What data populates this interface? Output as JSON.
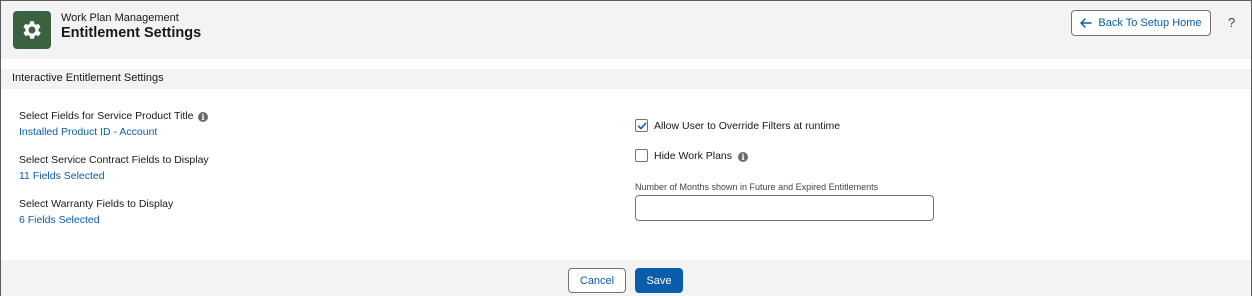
{
  "header": {
    "app_icon": "gear-icon",
    "subtitle": "Work Plan Management",
    "title": "Entitlement Settings",
    "back_button_label": "Back To Setup Home",
    "back_icon": "arrow-left-icon",
    "help_label": "?"
  },
  "section": {
    "title": "Interactive Entitlement Settings"
  },
  "left_fields": [
    {
      "label": "Select Fields for Service Product Title",
      "value": "Installed Product ID - Account",
      "has_info_icon": true
    },
    {
      "label": "Select Service Contract Fields to Display",
      "value": "11 Fields Selected",
      "has_info_icon": false
    },
    {
      "label": "Select Warranty Fields to Display",
      "value": "6 Fields Selected",
      "has_info_icon": false
    }
  ],
  "right_fields": {
    "override_filters": {
      "label": "Allow User to Override Filters at runtime",
      "checked": true
    },
    "hide_work_plans": {
      "label": "Hide Work Plans",
      "checked": false,
      "has_info_icon": true
    },
    "months_field": {
      "label": "Number of Months shown in Future and Expired Entitlements",
      "value": "",
      "placeholder": ""
    }
  },
  "footer": {
    "cancel_label": "Cancel",
    "save_label": "Save"
  },
  "colors": {
    "brand_icon_bg": "#3a6140",
    "link": "#0b5cab",
    "primary_button": "#0b5cab",
    "panel_bg": "#f3f3f3"
  }
}
